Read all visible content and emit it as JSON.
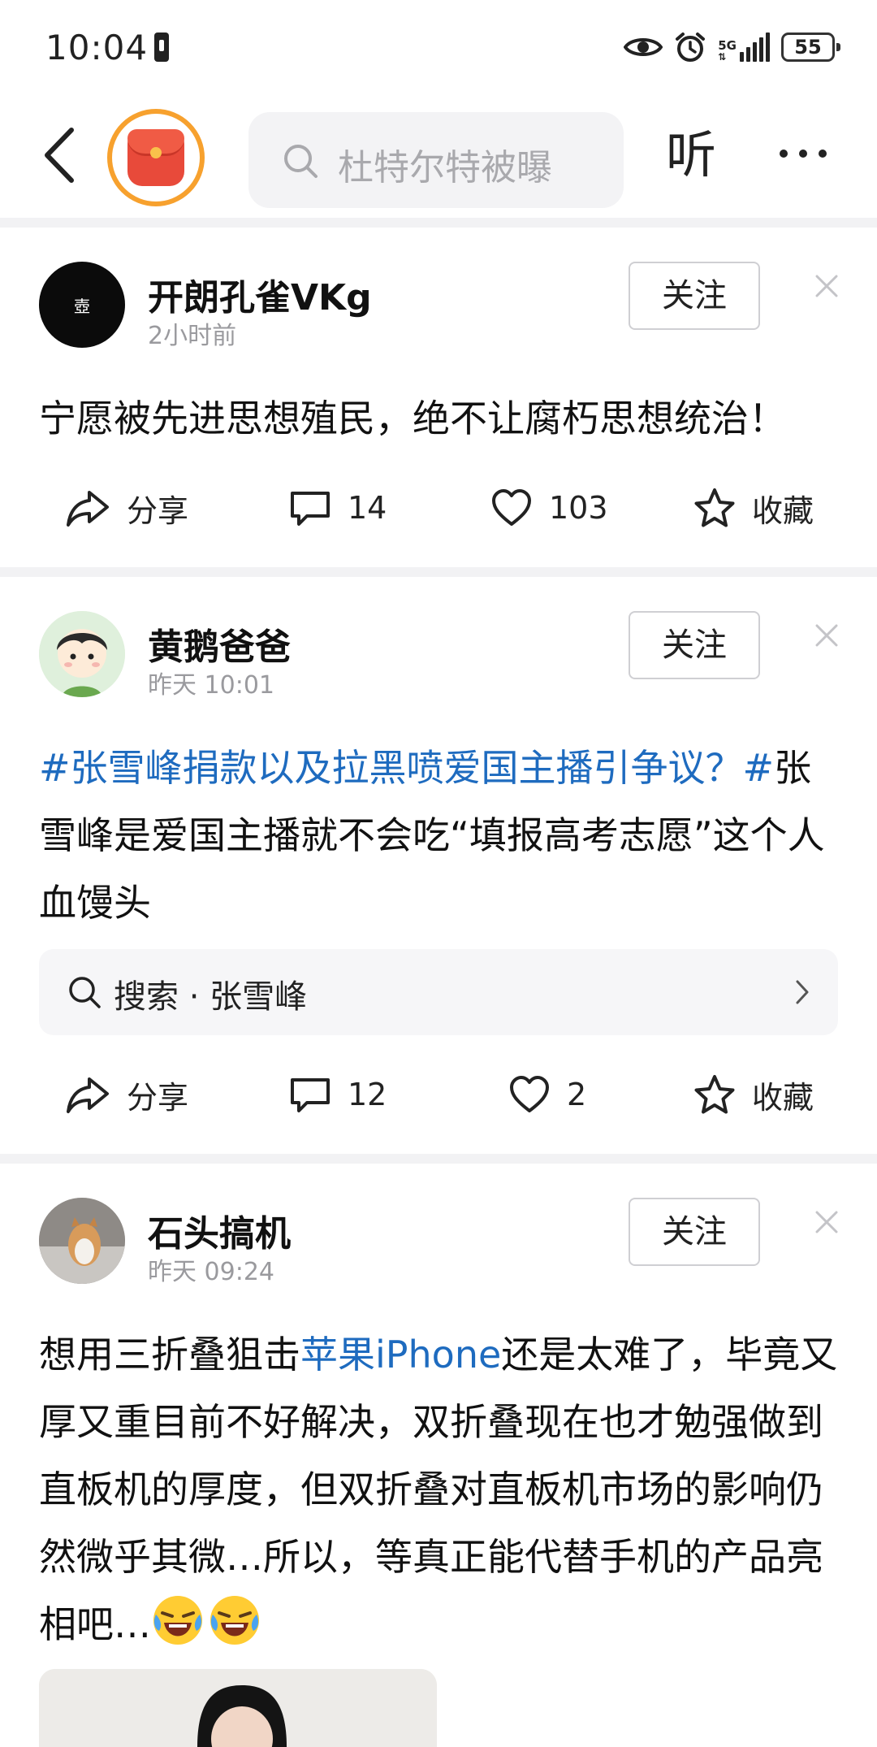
{
  "status_bar": {
    "time": "10:04",
    "network": "5G",
    "battery": "55"
  },
  "top_nav": {
    "search_placeholder": "杜特尔特被曝",
    "listen_label": "听"
  },
  "posts": [
    {
      "username": "开朗孔雀VKg",
      "avatar_text": "壺",
      "time": "2小时前",
      "follow_label": "关注",
      "text": "宁愿被先进思想殖民，绝不让腐朽思想统治！",
      "actions": {
        "share": "分享",
        "comments": "14",
        "likes": "103",
        "favorite": "收藏"
      }
    },
    {
      "username": "黄鹅爸爸",
      "time": "昨天  10:01",
      "follow_label": "关注",
      "hashtag": "#张雪峰捐款以及拉黑喷爱国主播引争议？#",
      "text": "张雪峰是爱国主播就不会吃“填报高考志愿”这个人血馒头",
      "search_chip": "搜索 · 张雪峰",
      "actions": {
        "share": "分享",
        "comments": "12",
        "likes": "2",
        "favorite": "收藏"
      }
    },
    {
      "username": "石头搞机",
      "time": "昨天  09:24",
      "follow_label": "关注",
      "text_before": "想用三折叠狙击",
      "link": "苹果iPhone",
      "text_after": "还是太难了，毕竟又厚又重目前不好解决，双折叠现在也才勉强做到直板机的厚度，但双折叠对直板机市场的影响仍然微乎其微…所以，等真正能代替手机的产品亮相吧…"
    }
  ],
  "colors": {
    "link": "#1e6bbf",
    "divider": "#f2f2f4",
    "muted": "#9a9a9e",
    "red_packet": "#e84a3a",
    "red_packet_ring": "#f7a12e"
  }
}
